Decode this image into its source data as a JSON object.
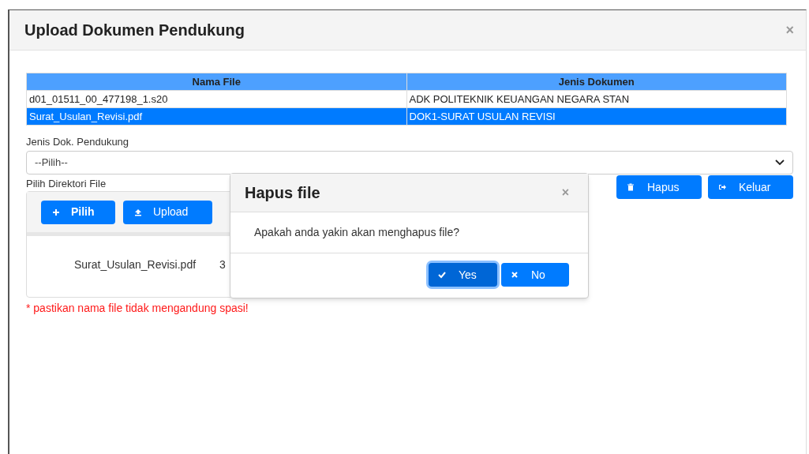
{
  "modal": {
    "title": "Upload Dokumen Pendukung",
    "close": "×"
  },
  "table": {
    "columns": [
      "Nama File",
      "Jenis Dokumen"
    ],
    "rows": [
      {
        "cells": [
          "d01_01511_00_477198_1.s20",
          "ADK POLITEKNIK KEUANGAN NEGARA STAN"
        ],
        "selected": false
      },
      {
        "cells": [
          "Surat_Usulan_Revisi.pdf",
          "DOK1-SURAT USULAN REVISI"
        ],
        "selected": true
      }
    ]
  },
  "jenis_field": {
    "label": "Jenis Dok. Pendukung",
    "value": "--Pilih--"
  },
  "directory": {
    "label": "Pilih Direktori File",
    "buttons": [
      {
        "kind": "plus",
        "label": "Pilih"
      },
      {
        "kind": "upload",
        "label": "Upload"
      }
    ],
    "file": {
      "name": "Surat_Usulan_Revisi.pdf",
      "column_2": "3"
    }
  },
  "actions": [
    {
      "kind": "trash",
      "label": "Hapus"
    },
    {
      "kind": "exit",
      "label": "Keluar"
    }
  ],
  "note": "* pastikan nama file tidak mengandung spasi!",
  "dialog": {
    "title": "Hapus file",
    "close": "×",
    "message": "Apakah anda yakin akan menghapus file?",
    "buttons": [
      {
        "kind": "check",
        "label": "Yes",
        "focused": true
      },
      {
        "kind": "cross",
        "label": "No",
        "focused": false
      }
    ]
  }
}
